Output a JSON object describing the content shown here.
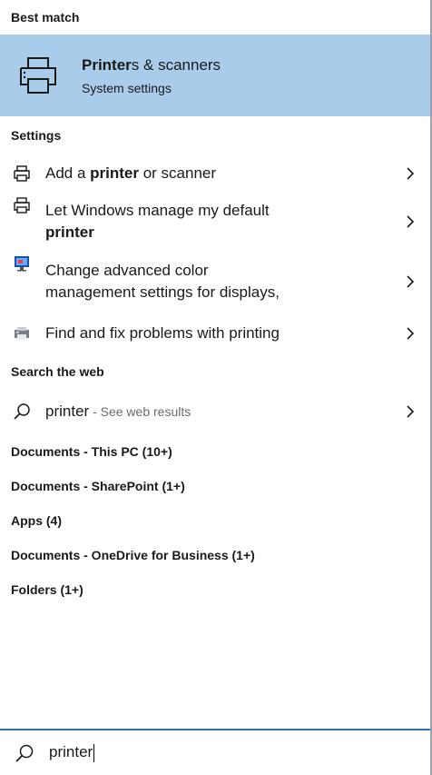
{
  "best_match": {
    "header": "Best match",
    "title_bold": "Printer",
    "title_rest": "s & scanners",
    "subtitle": "System settings",
    "icon": "printer-icon"
  },
  "settings": {
    "header": "Settings",
    "items": [
      {
        "pre": "Add a ",
        "bold": "printer",
        "post": " or scanner",
        "icon": "printer-small-icon"
      },
      {
        "line1": "Let Windows manage my default",
        "bold": "printer",
        "icon": "printer-small-icon"
      },
      {
        "line1": "Change advanced color",
        "line2": "management settings for displays,",
        "icon": "display-color-icon"
      },
      {
        "text": "Find and fix problems with printing",
        "icon": "printer-troubleshoot-icon"
      }
    ]
  },
  "web": {
    "header": "Search the web",
    "query": "printer",
    "suffix": " - See web results",
    "icon": "search-icon"
  },
  "categories": [
    "Documents - This PC (10+)",
    "Documents - SharePoint (1+)",
    "Apps (4)",
    "Documents - OneDrive for Business (1+)",
    "Folders (1+)"
  ],
  "search": {
    "value": "printer",
    "icon": "search-icon"
  }
}
